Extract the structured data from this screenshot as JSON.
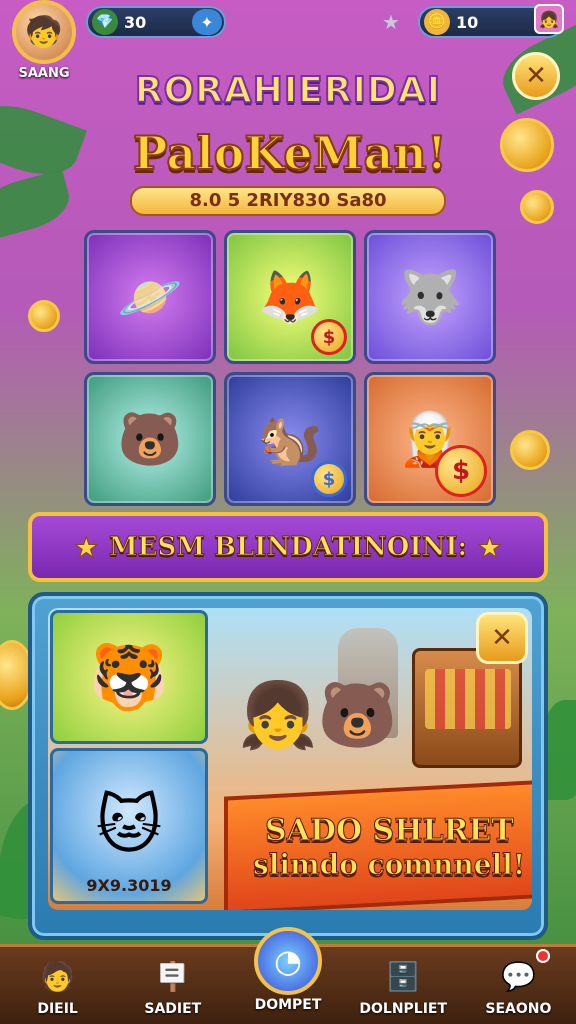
{
  "top_bar": {
    "player_name": "SAANG",
    "currency_left_value": "30",
    "currency_right_value": "10"
  },
  "title": {
    "line1": "RORAHIERIDAI",
    "line2": "PaloKeMan!",
    "subtitle": "8.0 5 2RIY830 Sa80"
  },
  "cards": [
    {
      "icon": "🪐",
      "has_coin": false
    },
    {
      "icon": "🦊",
      "has_coin": true
    },
    {
      "icon": "🐺",
      "has_coin": false
    },
    {
      "icon": "🐻",
      "has_coin": false
    },
    {
      "icon": "🐿️",
      "has_coin": true
    },
    {
      "icon": "🧝",
      "has_coin": true
    }
  ],
  "coin_symbol": "$",
  "banner": {
    "text": "MESM BLINDATINOINI:"
  },
  "panel": {
    "tile_b_label": "9X9.3019",
    "promo_line1": "SADO SHLRET",
    "promo_line2": "slimdo comnnell!"
  },
  "bottom_nav": [
    {
      "label": "DIEIL",
      "icon": "🧑"
    },
    {
      "label": "SADIET",
      "icon": "🪧"
    },
    {
      "label": "DOMPET",
      "icon": "◔"
    },
    {
      "label": "DOLNPLIET",
      "icon": "🗄️"
    },
    {
      "label": "SEAONO",
      "icon": "💬"
    }
  ],
  "colors": {
    "accent": "#f5c03a",
    "banner": "#7a28b0",
    "panel": "#2a7bb0"
  }
}
